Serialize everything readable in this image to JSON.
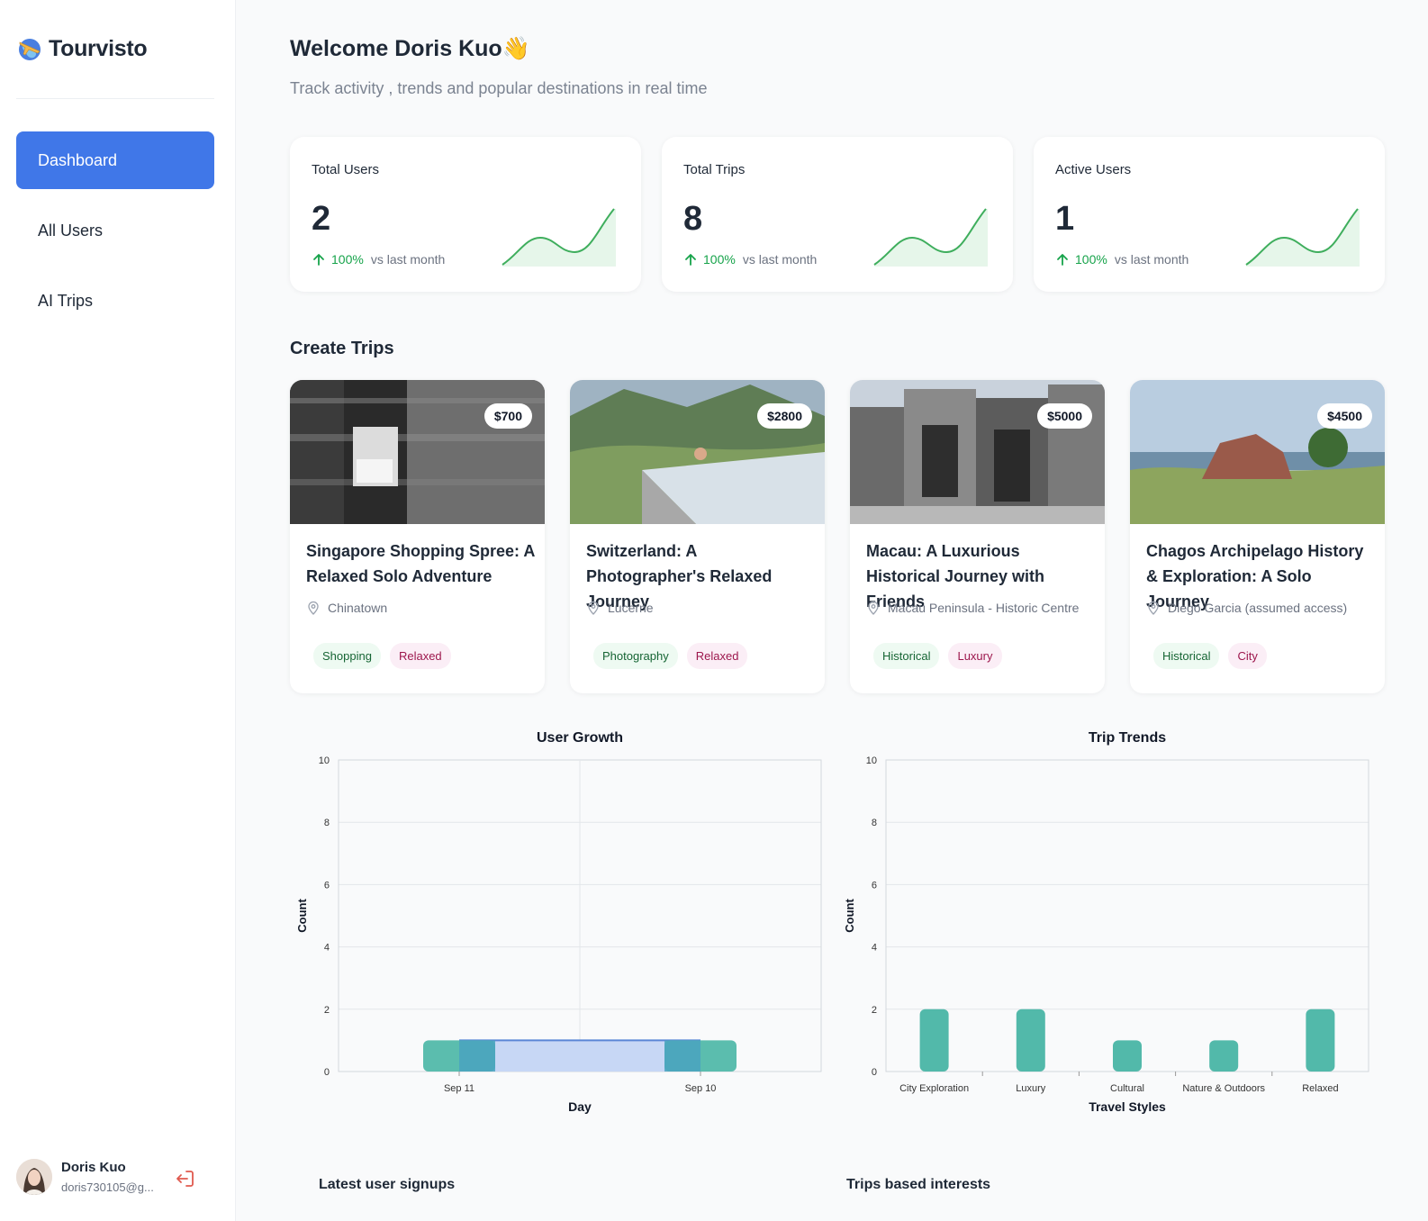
{
  "brand": {
    "name": "Tourvisto",
    "logo_icon": "globe-plane-icon"
  },
  "sidebar": {
    "items": [
      {
        "label": "Dashboard",
        "active": true
      },
      {
        "label": "All Users",
        "active": false
      },
      {
        "label": "AI Trips",
        "active": false
      }
    ],
    "user": {
      "name": "Doris Kuo",
      "email": "doris730105@g...",
      "logout_icon": "logout-icon"
    }
  },
  "header": {
    "title": "Welcome Doris Kuo👋",
    "subtitle": "Track activity , trends and popular destinations in real time"
  },
  "stats": [
    {
      "label": "Total Users",
      "value": "2",
      "change": "100%",
      "change_text": "vs last month"
    },
    {
      "label": "Total Trips",
      "value": "8",
      "change": "100%",
      "change_text": "vs last month"
    },
    {
      "label": "Active Users",
      "value": "1",
      "change": "100%",
      "change_text": "vs last month"
    }
  ],
  "trips_section": {
    "title": "Create Trips"
  },
  "trips": [
    {
      "price": "$700",
      "title": "Singapore Shopping Spree: A Relaxed Solo Adventure",
      "location": "Chinatown",
      "tags": [
        "Shopping",
        "Relaxed"
      ]
    },
    {
      "price": "$2800",
      "title": "Switzerland: A Photographer's Relaxed Journey",
      "location": "Lucerne",
      "tags": [
        "Photography",
        "Relaxed"
      ]
    },
    {
      "price": "$5000",
      "title": "Macau: A Luxurious Historical Journey with Friends",
      "location": "Macau Peninsula - Historic Centre",
      "tags": [
        "Historical",
        "Luxury"
      ]
    },
    {
      "price": "$4500",
      "title": "Chagos Archipelago History & Exploration: A Solo Journey",
      "location": "Diego Garcia (assumed access)",
      "tags": [
        "Historical",
        "City"
      ]
    }
  ],
  "colors": {
    "accent": "#4077e8",
    "bar": "#52b9aa",
    "area_fill": "#c7d7f5",
    "area_line": "#5a86d6",
    "trend_green": "#16a34a"
  },
  "chart_data": [
    {
      "type": "bar",
      "title": "User Growth",
      "xlabel": "Day",
      "ylabel": "Count",
      "categories": [
        "Sep 11",
        "Sep 10"
      ],
      "series": [
        {
          "type": "bar",
          "values": [
            1,
            1
          ]
        },
        {
          "type": "area",
          "values": [
            1,
            1
          ]
        }
      ],
      "ylim": [
        0,
        10
      ],
      "yticks": [
        "0",
        "2",
        "4",
        "6",
        "8",
        "10"
      ],
      "grid": true
    },
    {
      "type": "bar",
      "title": "Trip Trends",
      "xlabel": "Travel Styles",
      "ylabel": "Count",
      "categories": [
        "City Exploration",
        "Luxury",
        "Cultural",
        "Nature & Outdoors",
        "Relaxed"
      ],
      "values": [
        2,
        2,
        1,
        1,
        2
      ],
      "ylim": [
        0,
        10
      ],
      "yticks": [
        "0",
        "2",
        "4",
        "6",
        "8",
        "10"
      ],
      "grid": true
    }
  ],
  "bottom": {
    "latest_signups_title": "Latest user signups",
    "trips_interests_title": "Trips based interests"
  }
}
